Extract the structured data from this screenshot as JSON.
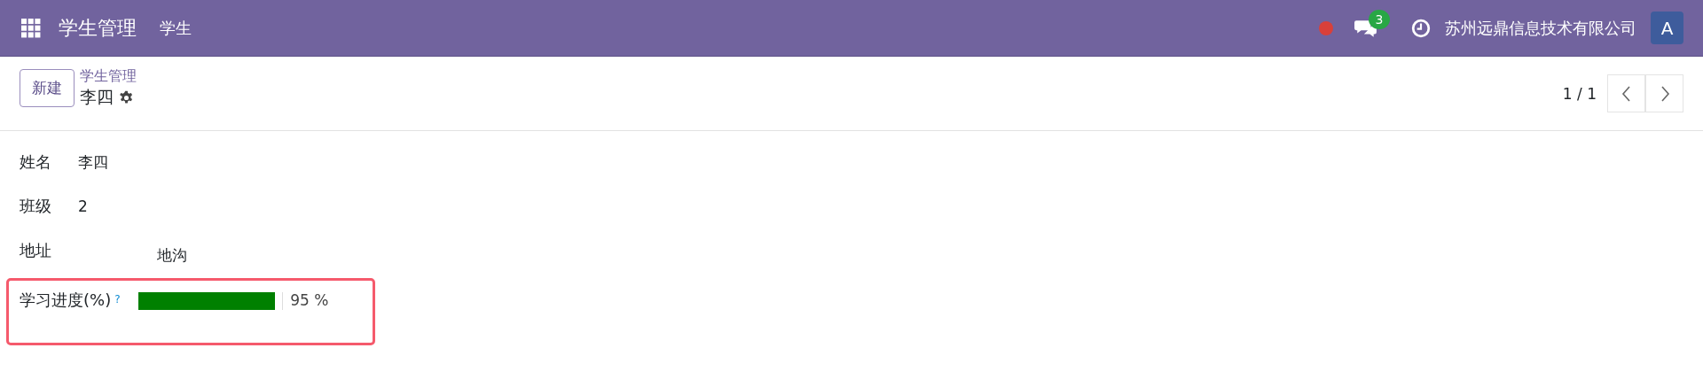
{
  "navbar": {
    "app_title": "学生管理",
    "menu": [
      "学生"
    ],
    "status_dot": {
      "color": "#d9403a"
    },
    "messages_badge": "3",
    "company": "苏州远鼎信息技术有限公司",
    "avatar": "A"
  },
  "control_panel": {
    "new_button": "新建",
    "breadcrumb": "学生管理",
    "record_title": "李四",
    "pager": "1 / 1"
  },
  "fields": [
    {
      "kind": "char",
      "label": "姓名",
      "value": "李四"
    },
    {
      "kind": "char",
      "label": "班级",
      "value": "2"
    },
    {
      "kind": "text",
      "label": "地址",
      "value": "地沟"
    },
    {
      "kind": "progress",
      "label": "学习进度(%)",
      "help": "?",
      "level": 0.95,
      "value": "95 %",
      "highlighted": true
    }
  ]
}
